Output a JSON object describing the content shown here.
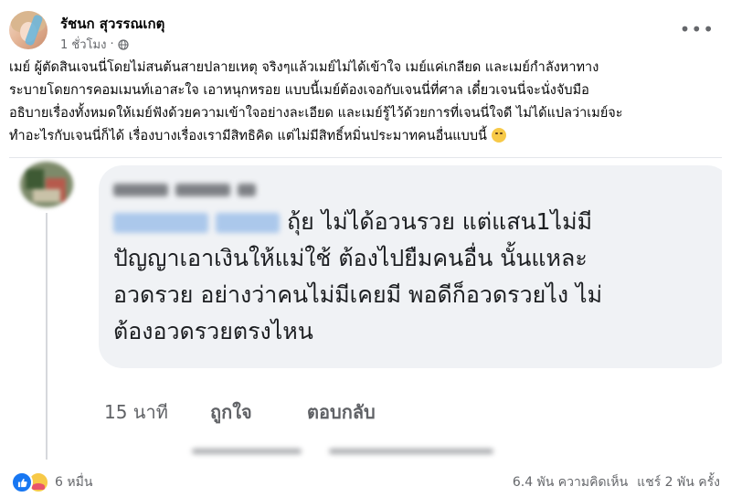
{
  "post": {
    "author": "รัชนก สุวรรณเกตุ",
    "time": "1 ชั่วโมง",
    "text": "เมย์ ผู้ตัดสินเจนนี่โดยไม่สนต้นสายปลายเหตุ จริงๆแล้วเมย์ไม่ได้เข้าใจ เมย์แค่เกลียด และเมย์กำลังหาทาง\nระบายโดยการคอมเมนท์เอาสะใจ เอาหนุกหรอย แบบนี้เมย์ต้องเจอกับเจนนี่ที่ศาล เดี๋ยวเจนนี่จะนั่งจับมือ\nอธิบายเรื่องทั้งหมดให้เมย์ฟังด้วยความเข้าใจอย่างละเอียด และเมย์รู้ไว้ด้วยการที่เจนนี่ใจดี ไม่ได้แปลว่าเมย์จะ\nทำอะไรกับเจนนี่ก็ได้ เรื่องบางเรื่องเรามีสิทธิคิด แต่ไม่มีสิทธิ์หมิ่นประมาทคนอื่นแบบนี้"
  },
  "comment": {
    "text": "ถุ้ย ไม่ได้อวนรวย แต่แสน1ไม่มี\nปัญญาเอาเงินให้แม่ใช้ ต้องไปยืมคนอื่น นั้นแหละ\nอวดรวย อย่างว่าคนไม่มีเคยมี พอดีก็อวดรวยไง ไม่\nต้องอวดรวยตรงไหน",
    "time": "15 นาที",
    "like_label": "ถูกใจ",
    "reply_label": "ตอบกลับ"
  },
  "footer": {
    "reaction_count": "6 หมื่น",
    "comments": "6.4 พัน ความคิดเห็น",
    "shares": "แชร์ 2 พัน ครั้ง"
  },
  "icons": {
    "more": "more-options-icon",
    "privacy": "globe-icon",
    "like": "like-reaction-icon",
    "care": "care-reaction-icon",
    "emoji": "smiling-face-emoji"
  },
  "colors": {
    "accent": "#1877f2",
    "muted_text": "#65676b",
    "bubble_bg": "#f0f2f5"
  }
}
